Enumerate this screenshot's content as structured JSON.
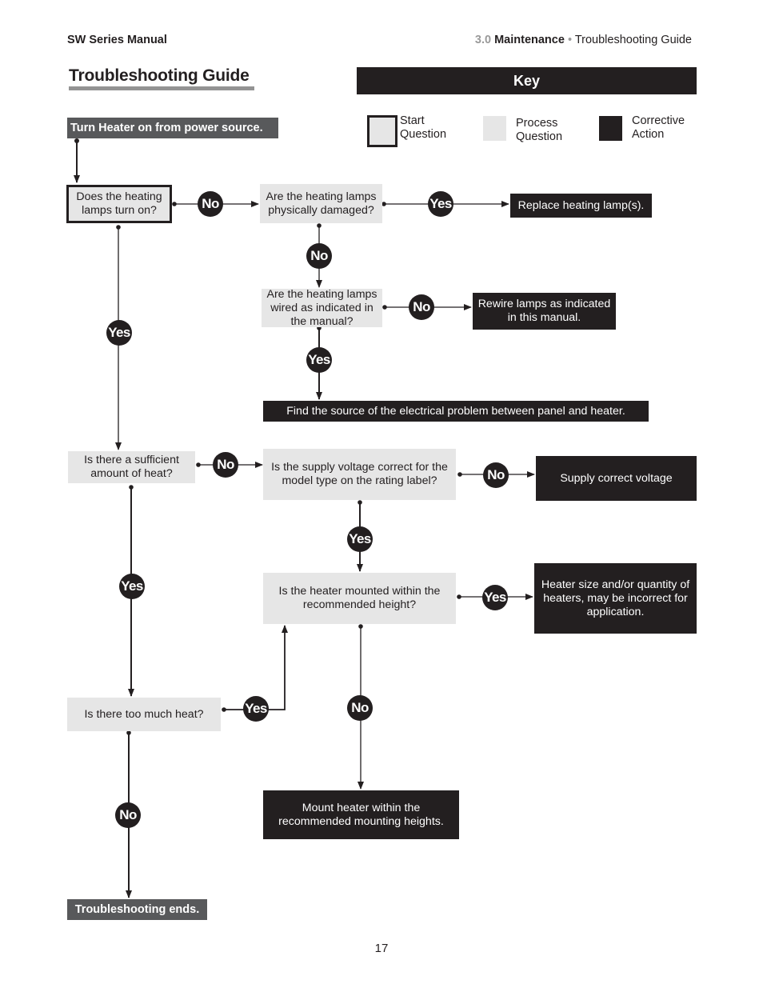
{
  "header": {
    "manual_name": "SW Series Manual",
    "section_number": "3.0",
    "section_name": "Maintenance",
    "separator": "•",
    "subsection": "Troubleshooting Guide"
  },
  "page_title": "Troubleshooting Guide",
  "key": {
    "title": "Key",
    "items": [
      {
        "type": "start",
        "label_line1": "Start",
        "label_line2": "Question"
      },
      {
        "type": "process",
        "label_line1": "Process",
        "label_line2": "Question"
      },
      {
        "type": "corrective",
        "label_line1": "Corrective",
        "label_line2": "Action"
      }
    ]
  },
  "colors": {
    "ink": "#231f20",
    "process_fill": "#e6e6e6",
    "terminal_fill": "#58595b",
    "title_underline": "#939393",
    "section_number": "#9a9a9a"
  },
  "flowchart": {
    "nodes": {
      "start": {
        "type": "terminal",
        "text": "Turn Heater on from power source."
      },
      "q_lamps_on": {
        "type": "start",
        "text": "Does the heating lamps turn on?"
      },
      "q_damaged": {
        "type": "process",
        "text": "Are the heating lamps physically damaged?"
      },
      "a_replace": {
        "type": "corrective",
        "text": "Replace heating lamp(s)."
      },
      "q_wired": {
        "type": "process",
        "text": "Are the heating lamps wired as indicated in the manual?"
      },
      "a_rewire": {
        "type": "corrective",
        "text": "Rewire lamps as indicated in this manual."
      },
      "a_find_source": {
        "type": "corrective",
        "text": "Find the source of the electrical problem between panel and heater."
      },
      "q_sufficient": {
        "type": "process",
        "text": "Is there a sufficient amount of heat?"
      },
      "q_voltage": {
        "type": "process",
        "text": "Is the supply voltage correct for the model type on the rating label?"
      },
      "a_voltage": {
        "type": "corrective",
        "text": "Supply correct voltage"
      },
      "q_mounted": {
        "type": "process",
        "text": "Is the heater mounted within the recommended height?"
      },
      "a_size": {
        "type": "corrective",
        "text": "Heater size and/or quantity of heaters, may be incorrect for application."
      },
      "q_too_much": {
        "type": "process",
        "text": "Is there too much heat?"
      },
      "a_mount": {
        "type": "corrective",
        "text": "Mount heater within the recommended mounting heights."
      },
      "end": {
        "type": "terminal",
        "text": "Troubleshooting ends."
      }
    },
    "edges": [
      {
        "from": "start",
        "to": "q_lamps_on",
        "label": ""
      },
      {
        "from": "q_lamps_on",
        "to": "q_damaged",
        "label": "No"
      },
      {
        "from": "q_damaged",
        "to": "a_replace",
        "label": "Yes"
      },
      {
        "from": "q_damaged",
        "to": "q_wired",
        "label": "No"
      },
      {
        "from": "q_wired",
        "to": "a_rewire",
        "label": "No"
      },
      {
        "from": "q_wired",
        "to": "a_find_source",
        "label": "Yes"
      },
      {
        "from": "q_lamps_on",
        "to": "q_sufficient",
        "label": "Yes"
      },
      {
        "from": "q_sufficient",
        "to": "q_voltage",
        "label": "No"
      },
      {
        "from": "q_voltage",
        "to": "a_voltage",
        "label": "No"
      },
      {
        "from": "q_voltage",
        "to": "q_mounted",
        "label": "Yes"
      },
      {
        "from": "q_mounted",
        "to": "a_size",
        "label": "Yes"
      },
      {
        "from": "q_mounted",
        "to": "a_mount",
        "label": "No"
      },
      {
        "from": "q_sufficient",
        "to": "q_too_much",
        "label": "Yes"
      },
      {
        "from": "q_too_much",
        "to": "q_mounted",
        "label": "Yes"
      },
      {
        "from": "q_too_much",
        "to": "end",
        "label": "No"
      }
    ]
  },
  "page_number": "17"
}
